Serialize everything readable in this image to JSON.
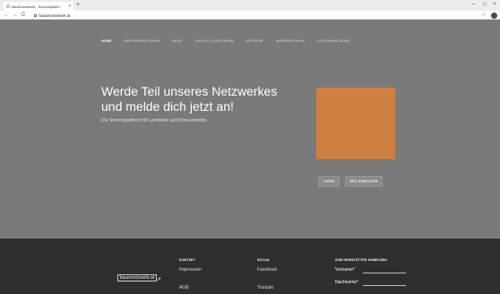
{
  "browser": {
    "tab_title": "bauernetzwerk - Servicepllattf...",
    "tab_close": "×",
    "new_tab": "+",
    "url": "bauernetzwerk.at",
    "back": "←",
    "forward": "→",
    "reload": "C",
    "minimize": "–",
    "maximize": "□",
    "close": "×",
    "star": "☆"
  },
  "nav": {
    "items": [
      {
        "label": "Home",
        "active": true
      },
      {
        "label": "Partner/Aktionen"
      },
      {
        "label": "News"
      },
      {
        "label": "Praxis & Zwischenn"
      },
      {
        "label": "Betriebe"
      },
      {
        "label": "Wissensforum"
      },
      {
        "label": "Loginanmeldung"
      }
    ]
  },
  "hero": {
    "title": "Werde Teil unseres Netzwerkes und melde dich jetzt an!",
    "subtitle": "Die Serviceplattform für Landwirte und Konsumenten.",
    "box_color": "#cf8041",
    "login_button": "Login",
    "register_button": "Neu anmelden"
  },
  "footer": {
    "kontakt_head": "Kontakt",
    "kontakt_links": [
      "Impressum",
      "AGB"
    ],
    "social_head": "Social",
    "social_links": [
      "Facebook",
      "Youtube"
    ],
    "newsletter_head": "Zum Newsletter anmelden",
    "firstname_label": "Vorname*",
    "lastname_label": "Nachname*",
    "logo_text": "bauernetzwerk.at"
  }
}
